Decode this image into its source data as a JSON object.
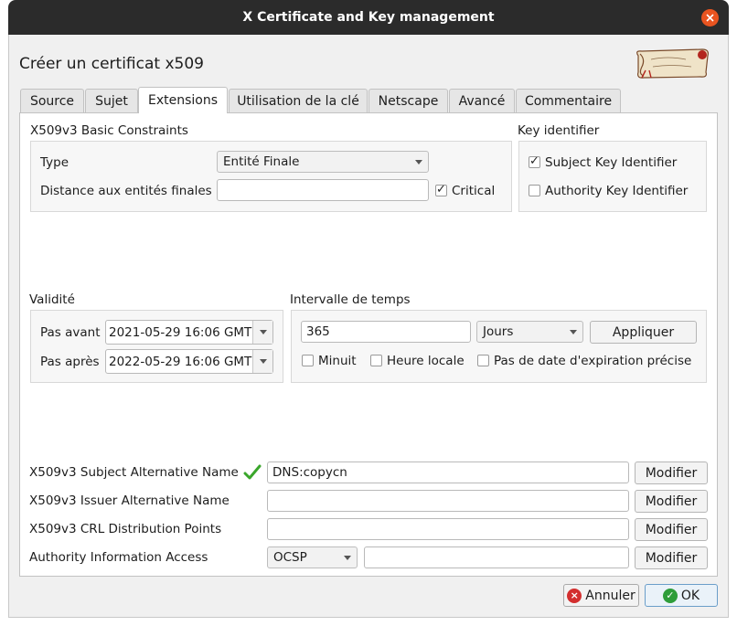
{
  "window": {
    "title": "X Certificate and Key management",
    "heading": "Créer un certificat x509"
  },
  "tabs": [
    {
      "label": "Source"
    },
    {
      "label": "Sujet"
    },
    {
      "label": "Extensions"
    },
    {
      "label": "Utilisation de la clé"
    },
    {
      "label": "Netscape"
    },
    {
      "label": "Avancé"
    },
    {
      "label": "Commentaire"
    }
  ],
  "basic_constraints": {
    "title": "X509v3 Basic Constraints",
    "type_label": "Type",
    "type_value": "Entité Finale",
    "distance_label": "Distance aux entités finales",
    "distance_value": "",
    "critical_label": "Critical",
    "critical_checked": true
  },
  "key_identifier": {
    "title": "Key identifier",
    "subject_label": "Subject Key Identifier",
    "subject_checked": true,
    "authority_label": "Authority Key Identifier",
    "authority_checked": false
  },
  "validity": {
    "title": "Validité",
    "not_before_label": "Pas avant",
    "not_before_value": "2021-05-29 16:06 GMT",
    "not_after_label": "Pas après",
    "not_after_value": "2022-05-29 16:06 GMT"
  },
  "time_range": {
    "title": "Intervalle de temps",
    "amount": "365",
    "unit": "Jours",
    "apply_label": "Appliquer",
    "midnight_label": "Minuit",
    "local_time_label": "Heure locale",
    "no_expiry_label": "Pas de date d'expiration précise"
  },
  "extensions": {
    "san_label": "X509v3 Subject Alternative Name",
    "san_value": "DNS:copycn",
    "ian_label": "X509v3 Issuer Alternative Name",
    "ian_value": "",
    "crl_label": "X509v3 CRL Distribution Points",
    "crl_value": "",
    "aia_label": "Authority Information Access",
    "aia_type": "OCSP",
    "aia_value": "",
    "modify_label": "Modifier"
  },
  "footer": {
    "cancel_label": "Annuler",
    "ok_label": "OK"
  },
  "colors": {
    "titlebar": "#2b2b2b",
    "close_button": "#e95420",
    "valid_check": "#3aa62b"
  }
}
